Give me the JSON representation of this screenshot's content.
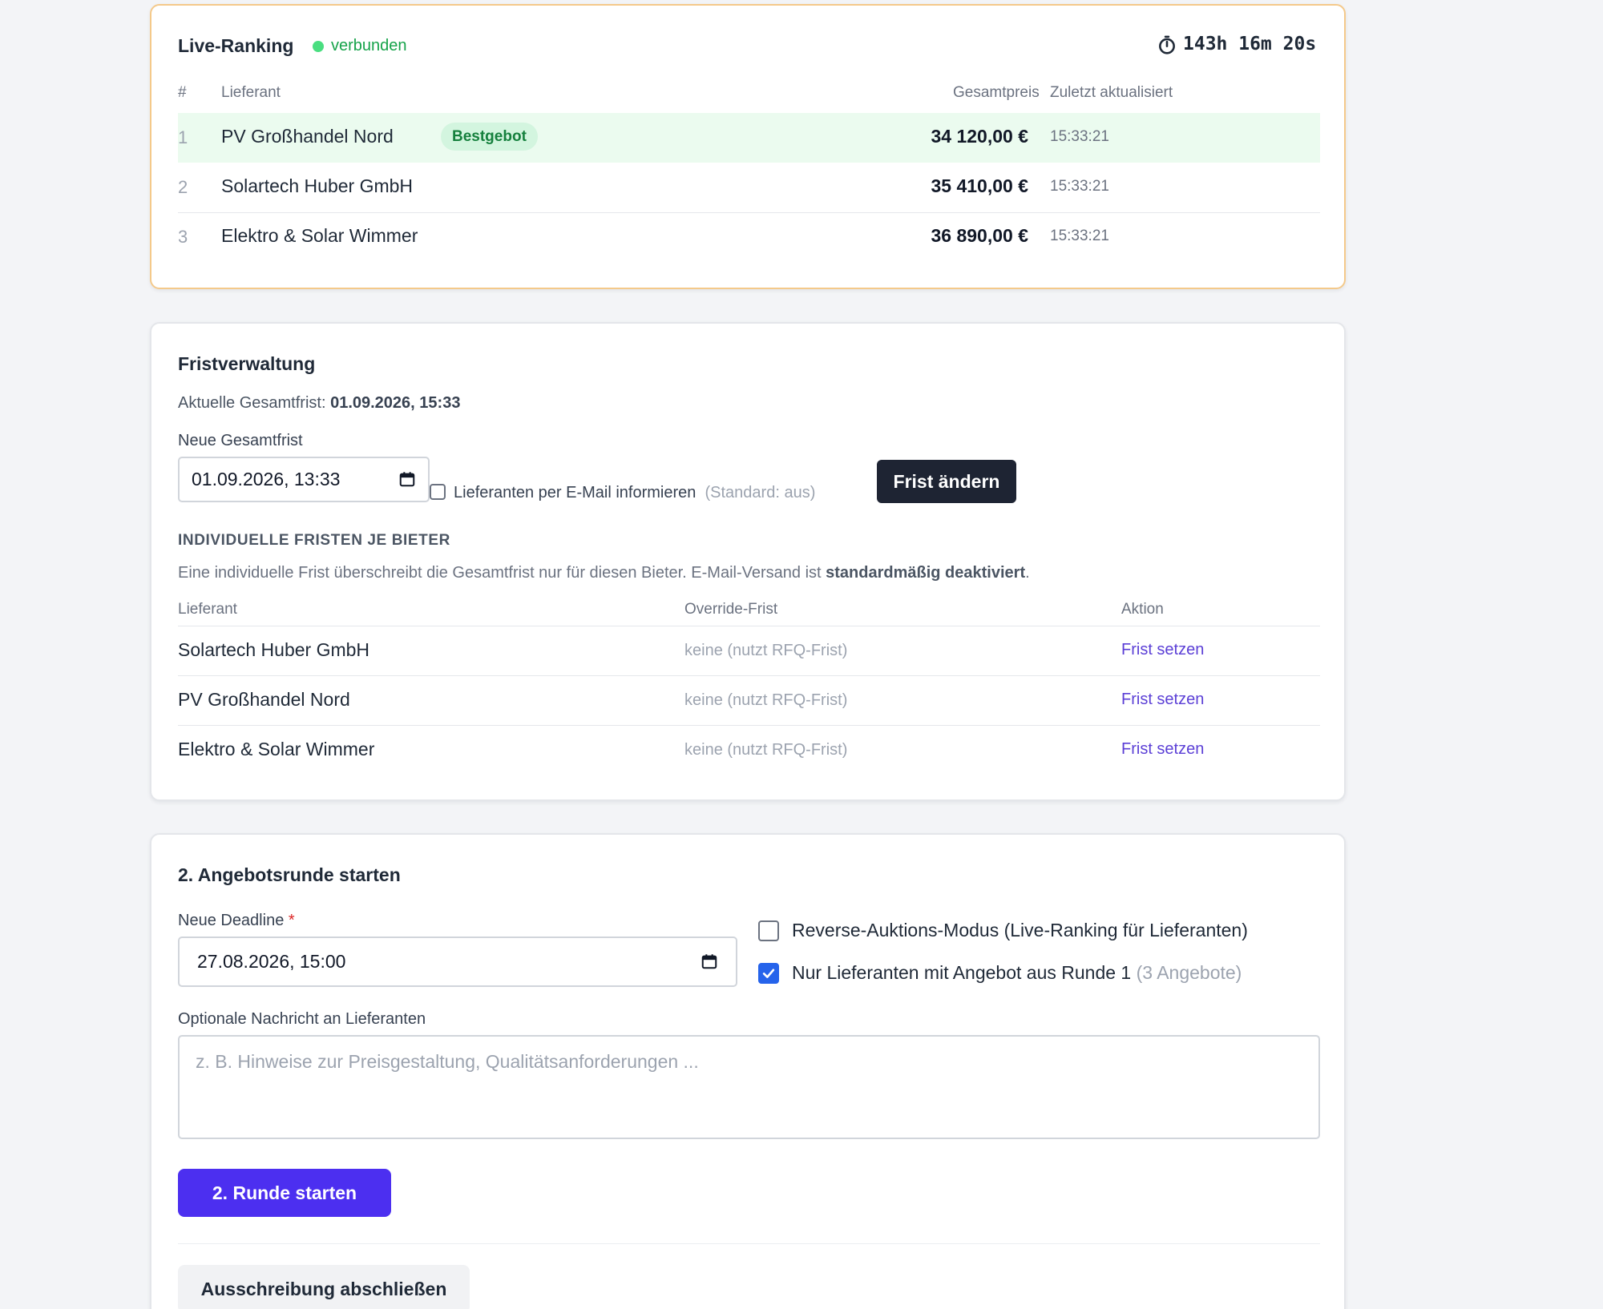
{
  "ranking": {
    "title": "Live-Ranking",
    "status": "verbunden",
    "timer": "143h 16m 20s",
    "headers": {
      "rank": "#",
      "supplier": "Lieferant",
      "total": "Gesamtpreis",
      "updated": "Zuletzt aktualisiert"
    },
    "best_badge": "Bestgebot",
    "rows": [
      {
        "rank": "1",
        "name": "PV Großhandel Nord",
        "price": "34 120,00 €",
        "time": "15:33:21"
      },
      {
        "rank": "2",
        "name": "Solartech Huber GmbH",
        "price": "35 410,00 €",
        "time": "15:33:21"
      },
      {
        "rank": "3",
        "name": "Elektro & Solar Wimmer",
        "price": "36 890,00 €",
        "time": "15:33:21"
      }
    ],
    "colors": {
      "best_row": "#ebfbef",
      "status": "#16a34a",
      "card_border": "#f4c98a"
    }
  },
  "frist": {
    "title": "Fristverwaltung",
    "current_label": "Aktuelle Gesamtfrist:",
    "current_value": "01.09.2026, 15:33",
    "new_label": "Neue Gesamtfrist",
    "new_value": "01.09.2026, 13:33",
    "email_label": "Lieferanten per E-Mail informieren",
    "email_hint": "(Standard: aus)",
    "email_checked": false,
    "change_button": "Frist ändern",
    "individual_title": "INDIVIDUELLE FRISTEN JE BIETER",
    "individual_desc_pre": "Eine individuelle Frist überschreibt die Gesamtfrist nur für diesen Bieter. E-Mail-Versand ist",
    "individual_desc_bold": "standardmäßig deaktiviert",
    "individual_desc_post": ".",
    "headers": {
      "supplier": "Lieferant",
      "override": "Override-Frist",
      "action": "Aktion"
    },
    "rows": [
      {
        "name": "Solartech Huber GmbH",
        "override": "keine (nutzt RFQ-Frist)",
        "action": "Frist setzen"
      },
      {
        "name": "PV Großhandel Nord",
        "override": "keine (nutzt RFQ-Frist)",
        "action": "Frist setzen"
      },
      {
        "name": "Elektro & Solar Wimmer",
        "override": "keine (nutzt RFQ-Frist)",
        "action": "Frist setzen"
      }
    ]
  },
  "round": {
    "title": "2. Angebotsrunde starten",
    "deadline_label": "Neue Deadline",
    "required_mark": "*",
    "deadline_value": "27.08.2026, 15:00",
    "reverse_label": "Reverse-Auktions-Modus (Live-Ranking für Lieferanten)",
    "reverse_checked": false,
    "only_label": "Nur Lieferanten mit Angebot aus Runde 1",
    "only_hint": "(3 Angebote)",
    "only_checked": true,
    "message_label": "Optionale Nachricht an Lieferanten",
    "message_placeholder": "z. B. Hinweise zur Preisgestaltung, Qualitätsanforderungen ...",
    "start_button": "2. Runde starten",
    "close_button": "Ausschreibung abschließen",
    "colors": {
      "primary": "#4c2ff0",
      "checkbox": "#2563eb"
    }
  }
}
